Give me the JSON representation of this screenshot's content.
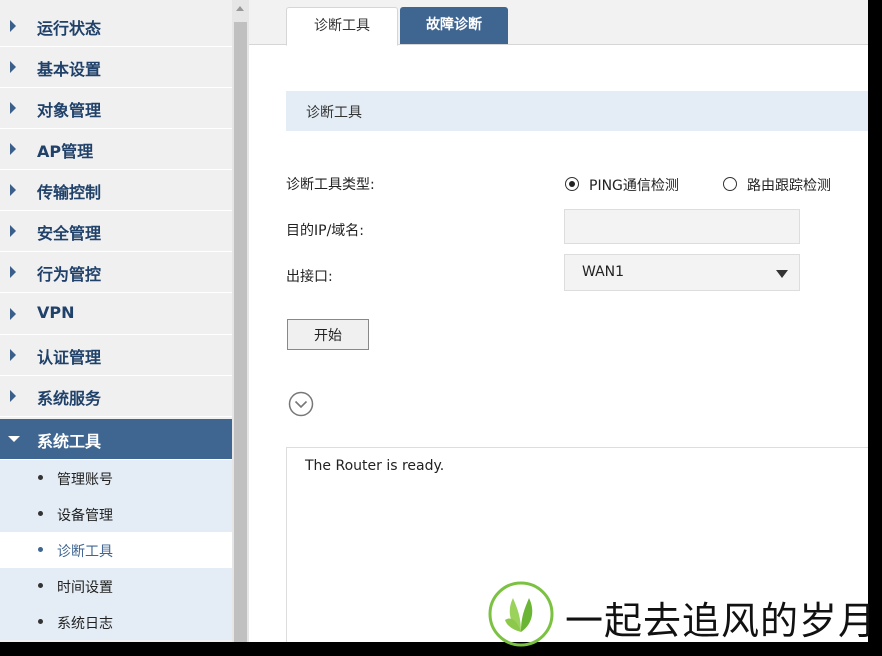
{
  "sidebar": {
    "items": [
      {
        "label": "运行状态"
      },
      {
        "label": "基本设置"
      },
      {
        "label": "对象管理"
      },
      {
        "label": "AP管理"
      },
      {
        "label": "传输控制"
      },
      {
        "label": "安全管理"
      },
      {
        "label": "行为管控"
      },
      {
        "label": "VPN"
      },
      {
        "label": "认证管理"
      },
      {
        "label": "系统服务"
      },
      {
        "label": "系统工具"
      }
    ],
    "subitems": [
      {
        "label": "管理账号"
      },
      {
        "label": "设备管理"
      },
      {
        "label": "诊断工具"
      },
      {
        "label": "时间设置"
      },
      {
        "label": "系统日志"
      }
    ],
    "active_item": "系统工具",
    "current_subitem": "诊断工具"
  },
  "tabs": {
    "diag_tools": "诊断工具",
    "fault_diag": "故障诊断"
  },
  "section": {
    "title": "诊断工具"
  },
  "form": {
    "type_label": "诊断工具类型:",
    "radio_ping": "PING通信检测",
    "radio_trace": "路由跟踪检测",
    "selected_type": "PING通信检测",
    "ip_label": "目的IP/域名:",
    "ip_value": "",
    "iface_label": "出接口:",
    "iface_value": "WAN1",
    "start_button": "开始"
  },
  "output": {
    "text": "The Router is ready."
  },
  "watermark": {
    "text": "一起去追风的岁月"
  },
  "colors": {
    "accent": "#3f6591",
    "sidebar_bg": "#f0f0f0",
    "submenu_bg": "#e4edf5",
    "section_bg": "#e4edf5"
  }
}
